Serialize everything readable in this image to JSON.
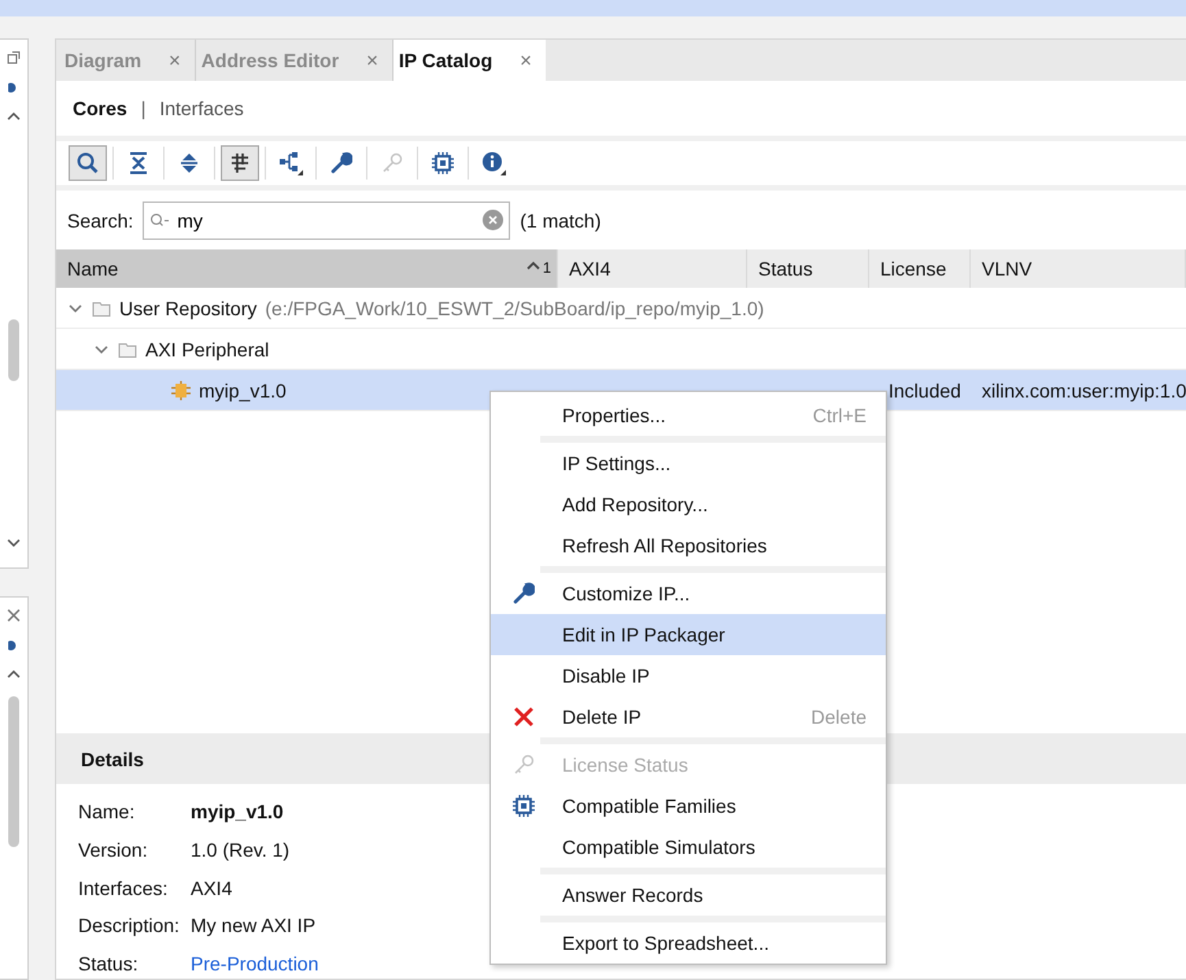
{
  "tabs": [
    {
      "label": "Diagram",
      "selected": false,
      "close": "×"
    },
    {
      "label": "Address Editor",
      "selected": false,
      "close": "×"
    },
    {
      "label": "IP Catalog",
      "selected": true,
      "close": "×"
    }
  ],
  "subtabs": [
    {
      "label": "Cores",
      "selected": true
    },
    {
      "label": "Interfaces",
      "selected": false
    }
  ],
  "subtab_separator": "|",
  "toolbar": [
    {
      "kind": "search",
      "pressed": true,
      "disabled": false
    },
    {
      "kind": "collapse",
      "pressed": false,
      "disabled": false
    },
    {
      "kind": "expand",
      "pressed": false,
      "disabled": false
    },
    {
      "kind": "filter",
      "pressed": true,
      "disabled": false
    },
    {
      "kind": "hierarchy",
      "pressed": false,
      "disabled": false
    },
    {
      "kind": "wrench",
      "pressed": false,
      "disabled": false
    },
    {
      "kind": "key",
      "pressed": false,
      "disabled": true
    },
    {
      "kind": "chip",
      "pressed": false,
      "disabled": false
    },
    {
      "kind": "info",
      "pressed": false,
      "disabled": false
    }
  ],
  "search": {
    "label": "Search:",
    "value": "my",
    "match_count": "(1 match)"
  },
  "table": {
    "columns": [
      {
        "label": "Name",
        "sorted": true,
        "sort_order": "1"
      },
      {
        "label": "AXI4",
        "sorted": false
      },
      {
        "label": "Status",
        "sorted": false
      },
      {
        "label": "License",
        "sorted": false
      },
      {
        "label": "VLNV",
        "sorted": false
      }
    ],
    "tree": [
      {
        "name": "User Repository",
        "detail": "(e:/FPGA_Work/10_ESWT_2/SubBoard/ip_repo/myip_1.0)",
        "kind": "folder",
        "expanded": true,
        "selected": false,
        "children": [
          {
            "name": "AXI Peripheral",
            "kind": "folder",
            "expanded": true,
            "selected": false,
            "children": [
              {
                "name": "myip_v1.0",
                "kind": "ip",
                "selected": true,
                "license": "Included",
                "vlnv": "xilinx.com:user:myip:1.0"
              }
            ]
          }
        ]
      }
    ]
  },
  "details": {
    "title": "Details",
    "fields": [
      {
        "label": "Name:",
        "value": "myip_v1.0",
        "kind": "bold"
      },
      {
        "label": "Version:",
        "value": "1.0 (Rev. 1)",
        "kind": "plain"
      },
      {
        "label": "Interfaces:",
        "value": "AXI4",
        "kind": "plain"
      },
      {
        "label": "Description:",
        "value": "My new AXI IP",
        "kind": "plain"
      },
      {
        "label": "Status:",
        "value": "Pre-Production",
        "kind": "link"
      }
    ]
  },
  "context_menu": {
    "groups": [
      [
        {
          "label": "Properties...",
          "shortcut": "Ctrl+E",
          "kind": "plain",
          "selected": false,
          "disabled": false
        }
      ],
      [
        {
          "label": "IP Settings...",
          "kind": "plain",
          "selected": false,
          "disabled": false
        },
        {
          "label": "Add Repository...",
          "kind": "plain",
          "selected": false,
          "disabled": false
        },
        {
          "label": "Refresh All Repositories",
          "kind": "plain",
          "selected": false,
          "disabled": false
        }
      ],
      [
        {
          "label": "Customize IP...",
          "kind": "wrench",
          "selected": false,
          "disabled": false
        },
        {
          "label": "Edit in IP Packager",
          "kind": "plain",
          "selected": true,
          "disabled": false
        },
        {
          "label": "Disable IP",
          "kind": "plain",
          "selected": false,
          "disabled": false
        },
        {
          "label": "Delete IP",
          "shortcut": "Delete",
          "kind": "delete",
          "selected": false,
          "disabled": false
        }
      ],
      [
        {
          "label": "License Status",
          "kind": "key",
          "selected": false,
          "disabled": true
        },
        {
          "label": "Compatible Families",
          "kind": "chip",
          "selected": false,
          "disabled": false
        },
        {
          "label": "Compatible Simulators",
          "kind": "plain",
          "selected": false,
          "disabled": false
        }
      ],
      [
        {
          "label": "Answer Records",
          "kind": "plain",
          "selected": false,
          "disabled": false
        }
      ],
      [
        {
          "label": "Export to Spreadsheet...",
          "kind": "plain",
          "selected": false,
          "disabled": false
        }
      ]
    ]
  }
}
